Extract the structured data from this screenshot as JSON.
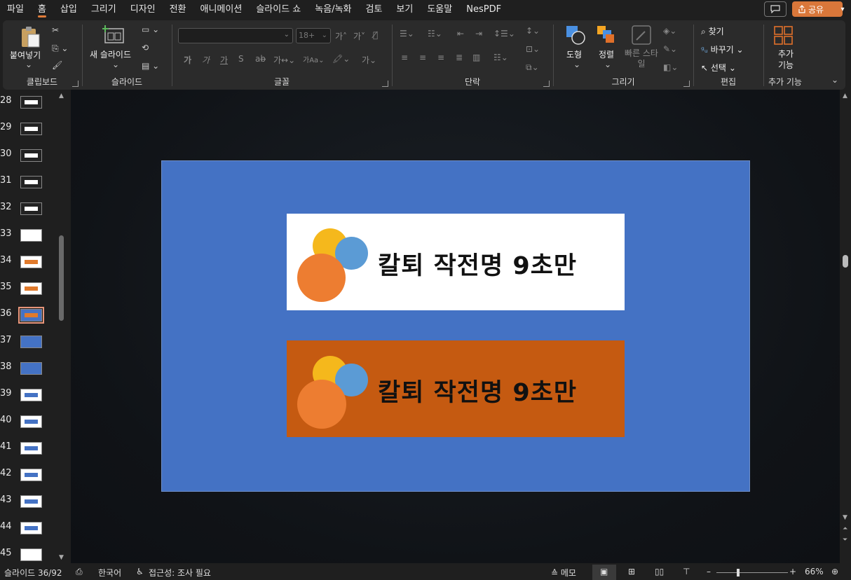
{
  "menu": {
    "items": [
      "파일",
      "홈",
      "삽입",
      "그리기",
      "디자인",
      "전환",
      "애니메이션",
      "슬라이드 쇼",
      "녹음/녹화",
      "검토",
      "보기",
      "도움말",
      "NesPDF"
    ],
    "active_index": 1,
    "share_label": "공유"
  },
  "ribbon": {
    "clipboard": {
      "paste_label": "붙여넣기",
      "group_label": "클립보드"
    },
    "slides": {
      "new_slide_label": "새 슬라이드",
      "group_label": "슬라이드"
    },
    "font": {
      "size_value": "18+",
      "group_label": "글꼴"
    },
    "paragraph": {
      "group_label": "단락"
    },
    "drawing": {
      "shapes_label": "도형",
      "arrange_label": "정렬",
      "quick_styles_label": "빠른 스타일",
      "group_label": "그리기"
    },
    "editing": {
      "find_label": "찾기",
      "replace_label": "바꾸기",
      "select_label": "선택",
      "group_label": "편집"
    },
    "addins": {
      "button_label": "추가 기능",
      "group_label": "추가 기능"
    }
  },
  "thumbnails": {
    "items": [
      {
        "num": "28",
        "style": "dark"
      },
      {
        "num": "29",
        "style": "dark"
      },
      {
        "num": "30",
        "style": "dark"
      },
      {
        "num": "31",
        "style": "dark"
      },
      {
        "num": "32",
        "style": "dark"
      },
      {
        "num": "33",
        "style": "white"
      },
      {
        "num": "34",
        "style": "orange"
      },
      {
        "num": "35",
        "style": "orange"
      },
      {
        "num": "36",
        "style": "blue-selected"
      },
      {
        "num": "37",
        "style": "blue"
      },
      {
        "num": "38",
        "style": "blue"
      },
      {
        "num": "39",
        "style": "light"
      },
      {
        "num": "40",
        "style": "light"
      },
      {
        "num": "41",
        "style": "light"
      },
      {
        "num": "42",
        "style": "light"
      },
      {
        "num": "43",
        "style": "light"
      },
      {
        "num": "44",
        "style": "light"
      },
      {
        "num": "45",
        "style": "white"
      }
    ]
  },
  "slide": {
    "background_color": "#4472c4",
    "banner_top_text": "칼퇴 작전명 9초만",
    "banner_bottom_text": "칼퇴 작전명 9초만",
    "circle_colors": {
      "yellow": "#f5b81c",
      "blue": "#5b9bd5",
      "orange": "#ed7d31"
    }
  },
  "status": {
    "slide_counter": "슬라이드 36/92",
    "language": "한국어",
    "accessibility": "접근성: 조사 필요",
    "notes_label": "메모",
    "zoom": "66%"
  }
}
